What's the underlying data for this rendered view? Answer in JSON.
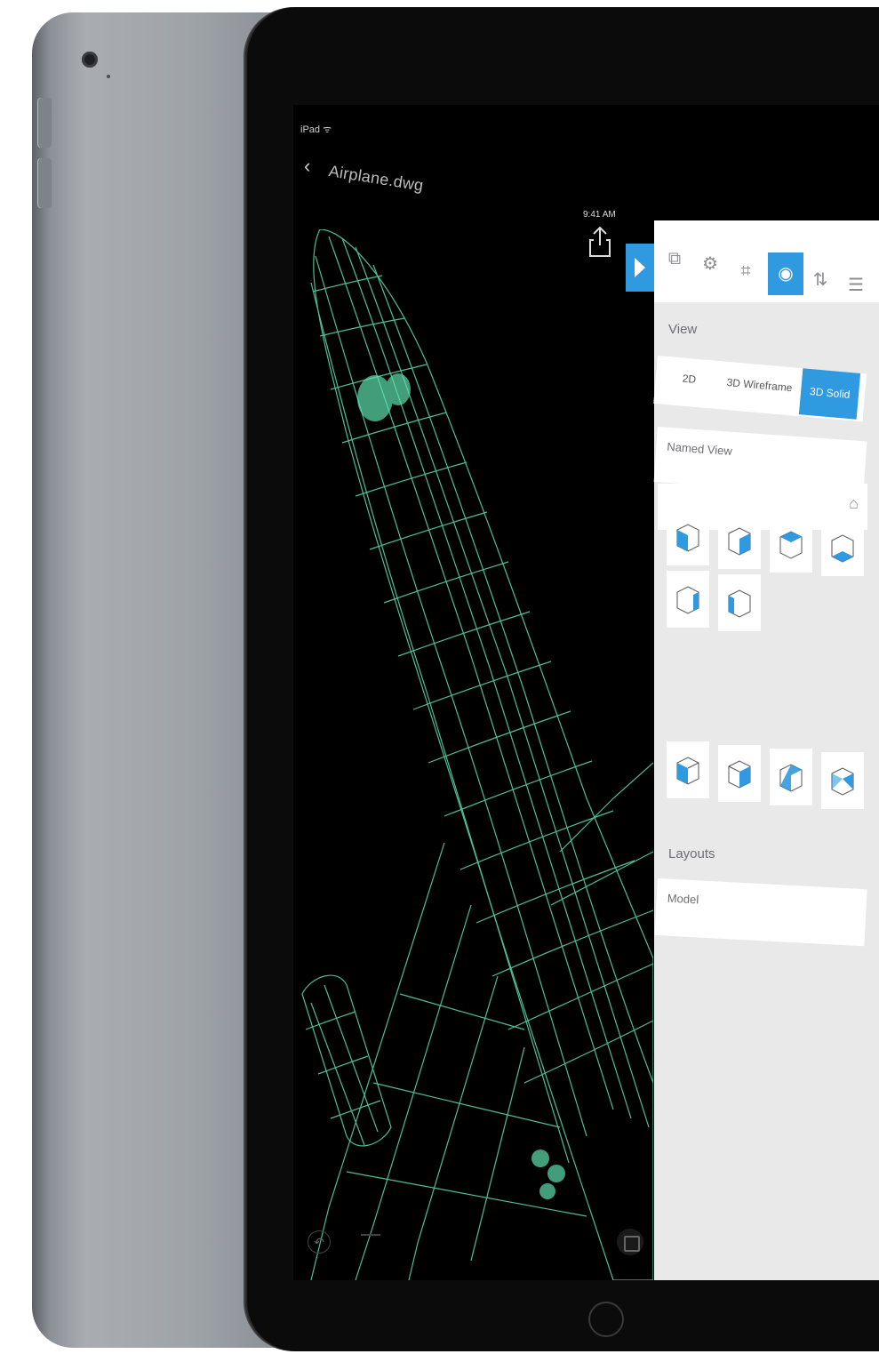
{
  "device": {
    "back_model": "iPad space gray (rear)",
    "front_model": "iPad Pro"
  },
  "status_bar": {
    "carrier": "iPad ᯤ",
    "time": "9:41 AM"
  },
  "nav": {
    "back_glyph": "‹",
    "document_title": "Airplane.dwg",
    "share_icon": "share-icon",
    "panel_toggle_icon": "play-icon"
  },
  "toolbar": {
    "items": [
      {
        "icon": "layers-icon",
        "glyph": "⧉"
      },
      {
        "icon": "settings-icon",
        "glyph": "⚙"
      },
      {
        "icon": "measure-icon",
        "glyph": "⌗"
      },
      {
        "icon": "view-icon",
        "glyph": "◉",
        "active": true
      },
      {
        "icon": "compare-icon",
        "glyph": "⇅"
      },
      {
        "icon": "properties-icon",
        "glyph": "☰"
      }
    ]
  },
  "view_panel": {
    "section_title": "View",
    "modes": [
      "2D",
      "3D Wireframe",
      "3D Solid"
    ],
    "selected_mode": "3D Solid",
    "named_view_label": "Named View",
    "home_icon": "⌂",
    "layouts_title": "Layouts",
    "layout_item": "Model"
  },
  "colors": {
    "accent": "#2f9ae0",
    "wireframe": "#5fe0b0",
    "panel_bg": "#e9e9ea",
    "screen_bg": "#000000"
  }
}
